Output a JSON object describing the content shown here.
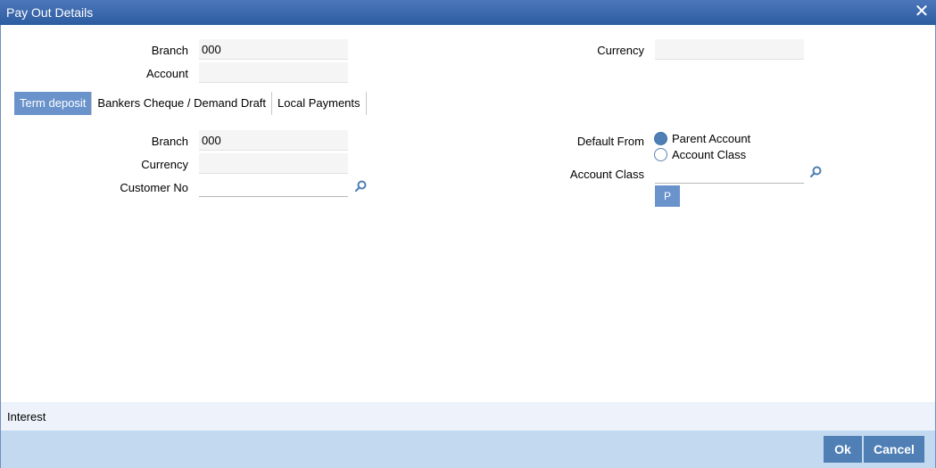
{
  "window": {
    "title": "Pay Out Details"
  },
  "header": {
    "branch_label": "Branch",
    "branch_value": "000",
    "account_label": "Account",
    "account_value": "",
    "currency_label": "Currency",
    "currency_value": ""
  },
  "tabs": [
    {
      "label": "Term deposit",
      "active": true
    },
    {
      "label": "Bankers Cheque / Demand Draft",
      "active": false
    },
    {
      "label": "Local Payments",
      "active": false
    }
  ],
  "term_deposit": {
    "branch_label": "Branch",
    "branch_value": "000",
    "currency_label": "Currency",
    "currency_value": "",
    "customer_no_label": "Customer No",
    "customer_no_value": "",
    "default_from_label": "Default From",
    "default_from_options": [
      {
        "label": "Parent Account",
        "selected": true
      },
      {
        "label": "Account Class",
        "selected": false
      }
    ],
    "account_class_label": "Account Class",
    "account_class_value": "",
    "p_button_label": "P"
  },
  "interest": {
    "label": "Interest"
  },
  "footer": {
    "ok_label": "Ok",
    "cancel_label": "Cancel"
  },
  "colors": {
    "titlebar": "#2d5ca1",
    "accent": "#6a93cc",
    "button": "#4f7fb5",
    "footer": "#c2d9ef"
  },
  "icons": {
    "close": "close-icon",
    "lookup": "search-icon"
  }
}
